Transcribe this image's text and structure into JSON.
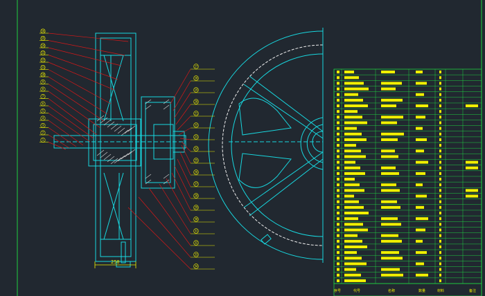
{
  "colors": {
    "background": "#212830",
    "drawing": "#18d8e0",
    "leader": "#d81818",
    "label_text": "#f0f000",
    "table_grid": "#20d040",
    "border": "#20d040",
    "hatch": "#d8d8d8",
    "white_line": "#ffffff"
  },
  "dimension": {
    "overall_width_label": "250"
  },
  "left_balloons": [
    "16",
    "15",
    "14",
    "13",
    "12",
    "11",
    "10",
    "9",
    "8",
    "7",
    "6",
    "5",
    "4",
    "3",
    "2",
    "1"
  ],
  "right_balloons": [
    "17",
    "18",
    "19",
    "20",
    "21",
    "22",
    "23",
    "24",
    "25",
    "26",
    "27",
    "28",
    "29",
    "30",
    "31",
    "32",
    "33",
    "34"
  ],
  "table": {
    "header": {
      "no": "序号",
      "code": "代号",
      "name": "名称",
      "qty": "数量",
      "material": "材料",
      "remark": "备注"
    },
    "row_numbers": [
      "",
      "",
      "",
      "",
      "",
      "",
      "",
      "",
      "",
      "",
      "",
      "",
      "",
      "",
      "",
      "",
      "",
      "",
      "",
      "",
      "",
      "",
      "",
      "",
      "",
      "",
      "",
      "",
      "",
      "",
      "",
      "",
      "",
      "19",
      "18",
      "17",
      "16",
      "15",
      "14",
      "13",
      "12",
      "11",
      "10",
      "9",
      "8",
      "7",
      "6",
      "5",
      "4",
      "3",
      "2",
      "1"
    ]
  }
}
